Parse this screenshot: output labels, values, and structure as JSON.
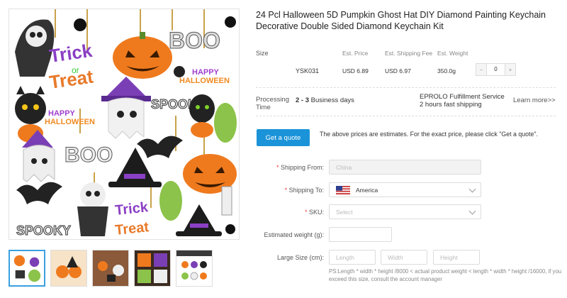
{
  "product": {
    "title": "24 Pcl Halloween 5D Pumpkin Ghost Hat DIY Diamond Painting Keychain Decorative Double Sided Diamond Keychain Kit"
  },
  "image_text": {
    "trick": "Trick",
    "or": "or",
    "treat": "Treat",
    "boo": "BOO",
    "happy": "HAPPY",
    "halloween": "HALLOWEEN",
    "spooky": "SPOOKY"
  },
  "variant_table": {
    "size_label": "Size",
    "headers": [
      "Est. Price",
      "Est. Shipping Fee",
      "Est. Weight"
    ],
    "row": {
      "sku": "YSK031",
      "price": "USD 6.89",
      "shipping_fee": "USD 6.97",
      "weight": "350.0g",
      "qty_minus": "−",
      "qty_value": "0",
      "qty_plus": "+"
    }
  },
  "processing": {
    "label": "Processing Time",
    "days_bold": "2 - 3",
    "days_rest": "Business days",
    "service_line1": "EPROLO Fulfillment Service",
    "service_line2": "2 hours fast shipping",
    "learn_more": "Learn more>>"
  },
  "quote": {
    "button": "Get a quote",
    "note": "The above prices are estimates. For the exact price, please click \"Get a quote\"."
  },
  "form": {
    "shipping_from_label": "Shipping From:",
    "shipping_from_value": "China",
    "shipping_to_label": "Shipping To:",
    "shipping_to_value": "America",
    "sku_label": "SKU:",
    "sku_placeholder": "Select",
    "weight_label": "Estimated weight (g):",
    "large_size_label": "Large Size (cm):",
    "length_placeholder": "Length",
    "width_placeholder": "Width",
    "height_placeholder": "Height",
    "required_mark": "*",
    "note": "PS:Length * width * height /8000 < actual product weight < length * width * height /16000, if you exceed this size, consult the account manager"
  },
  "colors": {
    "accent": "#1b93d8",
    "required": "#e44444",
    "thumb_active": "#3aa0e0"
  }
}
